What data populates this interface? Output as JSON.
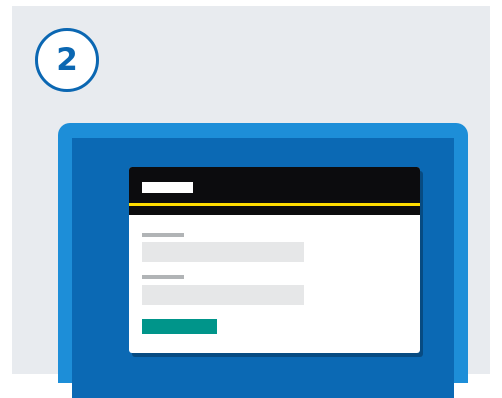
{
  "step": {
    "number": "2"
  },
  "colors": {
    "background": "#e8ebef",
    "accent_blue": "#0b67b2",
    "frame_blue": "#1d8ed8",
    "screen_blue": "#0b69b4",
    "header_black": "#0c0c0e",
    "header_rule_yellow": "#ffdd00",
    "field_label_grey": "#b1b4b6",
    "field_input_grey": "#e6e7e8",
    "button_green": "#00958a"
  },
  "form": {
    "fields": [
      {
        "name": "field-1"
      },
      {
        "name": "field-2"
      }
    ]
  }
}
